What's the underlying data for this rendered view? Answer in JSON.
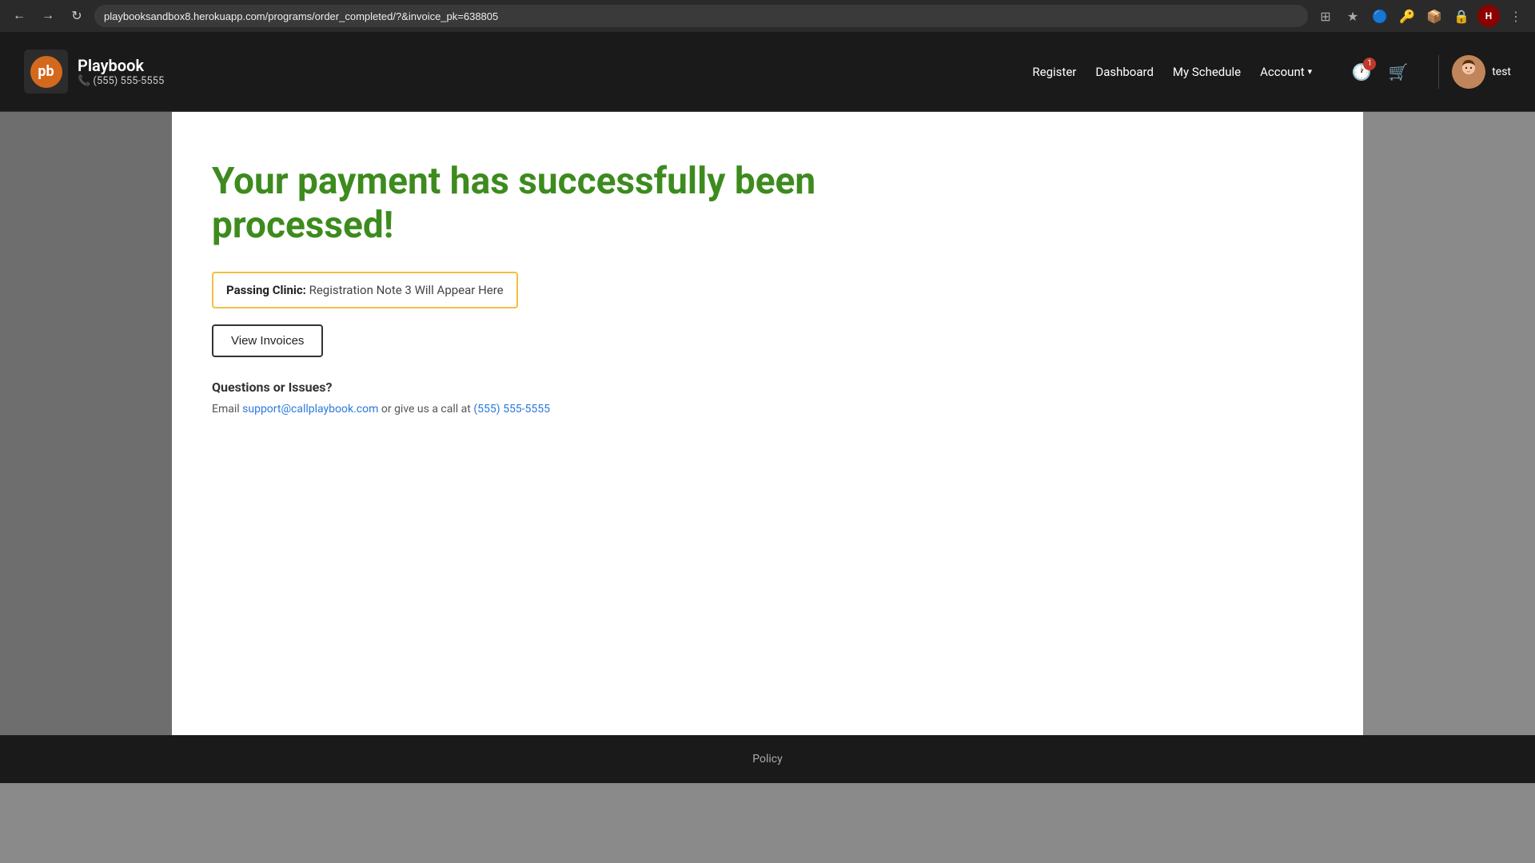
{
  "browser": {
    "url": "playbooksandbox8.herokuapp.com/programs/order_completed/?&invoice_pk=638805"
  },
  "header": {
    "brand_name": "Playbook",
    "brand_phone": "📞 (555) 555-5555",
    "nav": {
      "register": "Register",
      "dashboard": "Dashboard",
      "my_schedule": "My Schedule",
      "account": "Account",
      "username": "test"
    },
    "notification_badge": "1"
  },
  "main": {
    "success_heading_line1": "Your payment has successfully been",
    "success_heading_line2": "processed!",
    "clinic_note_label": "Passing Clinic:",
    "clinic_note_text": " Registration Note 3 Will Appear Here",
    "view_invoices_label": "View Invoices",
    "questions_heading": "Questions or Issues?",
    "contact_prefix": "Email ",
    "contact_email": "support@callplaybook.com",
    "contact_middle": " or give us a call at ",
    "contact_phone": "(555) 555-5555"
  },
  "footer": {
    "policy_label": "Policy"
  }
}
